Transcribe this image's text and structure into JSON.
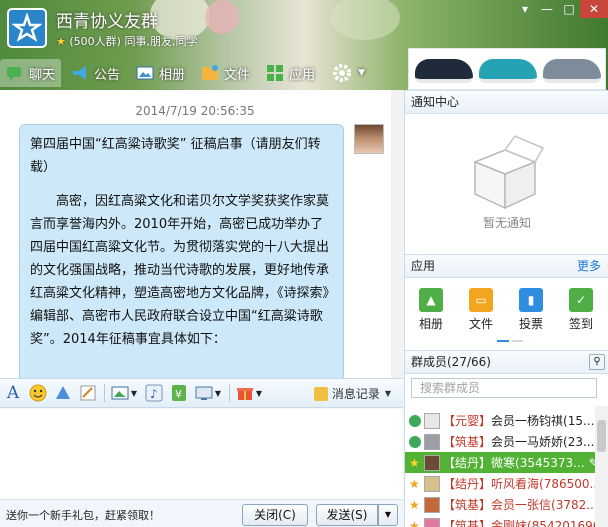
{
  "header": {
    "group_name": "西青协义友群",
    "member_count_text": "(500人群)",
    "tags": "同事,朋友,同学"
  },
  "tabs": [
    {
      "label": "聊天"
    },
    {
      "label": "公告"
    },
    {
      "label": "相册"
    },
    {
      "label": "文件"
    },
    {
      "label": "应用"
    }
  ],
  "chat": {
    "timestamp": "2014/7/19 20:56:35",
    "message_p1": "第四届中国“红高粱诗歌奖” 征稿启事（请朋友们转载）",
    "message_p2": "高密，因红高粱文化和诺贝尔文学奖获奖作家莫言而享誉海内外。2010年开始，高密已成功举办了四届中国红高粱文化节。为贯彻落实党的十八大提出的文化强国战略，推动当代诗歌的发展，更好地传承红高粱文化精神，塑造高密地方文化品牌，《诗探索》编辑部、高密市人民政府联合设立中国“红高粱诗歌奖”。2014年征稿事宜具体如下："
  },
  "toolbar": {
    "history_label": "消息记录"
  },
  "bottom": {
    "promo_text": "送你一个新手礼包，赶紧领取！",
    "close_label": "关闭(C)",
    "send_label": "发送(S)"
  },
  "side": {
    "notice_title": "通知中心",
    "notice_empty": "暂无通知",
    "apps_title": "应用",
    "more_label": "更多",
    "apps": [
      {
        "label": "相册"
      },
      {
        "label": "文件"
      },
      {
        "label": "投票"
      },
      {
        "label": "签到"
      }
    ],
    "members_title": "群成员(27/66)",
    "search_placeholder": "搜索群成员",
    "members": [
      {
        "tag": "【元婴】",
        "name": "会员一杨钧祺(15..."
      },
      {
        "tag": "【筑基】",
        "name": "会员一马娇娇(23..."
      },
      {
        "tag": "【结丹】",
        "name": "微寒(3545373..."
      },
      {
        "tag": "【结丹】",
        "name": "听风看海(786500..."
      },
      {
        "tag": "【筑基】",
        "name": "会员一张信(3782..."
      },
      {
        "tag": "【筑基】",
        "name": "金剛妹(854201696)"
      }
    ]
  },
  "colors": {
    "selected_row": "#52b233",
    "link_blue": "#1d7ad9",
    "bubble": "#cde8f8"
  }
}
